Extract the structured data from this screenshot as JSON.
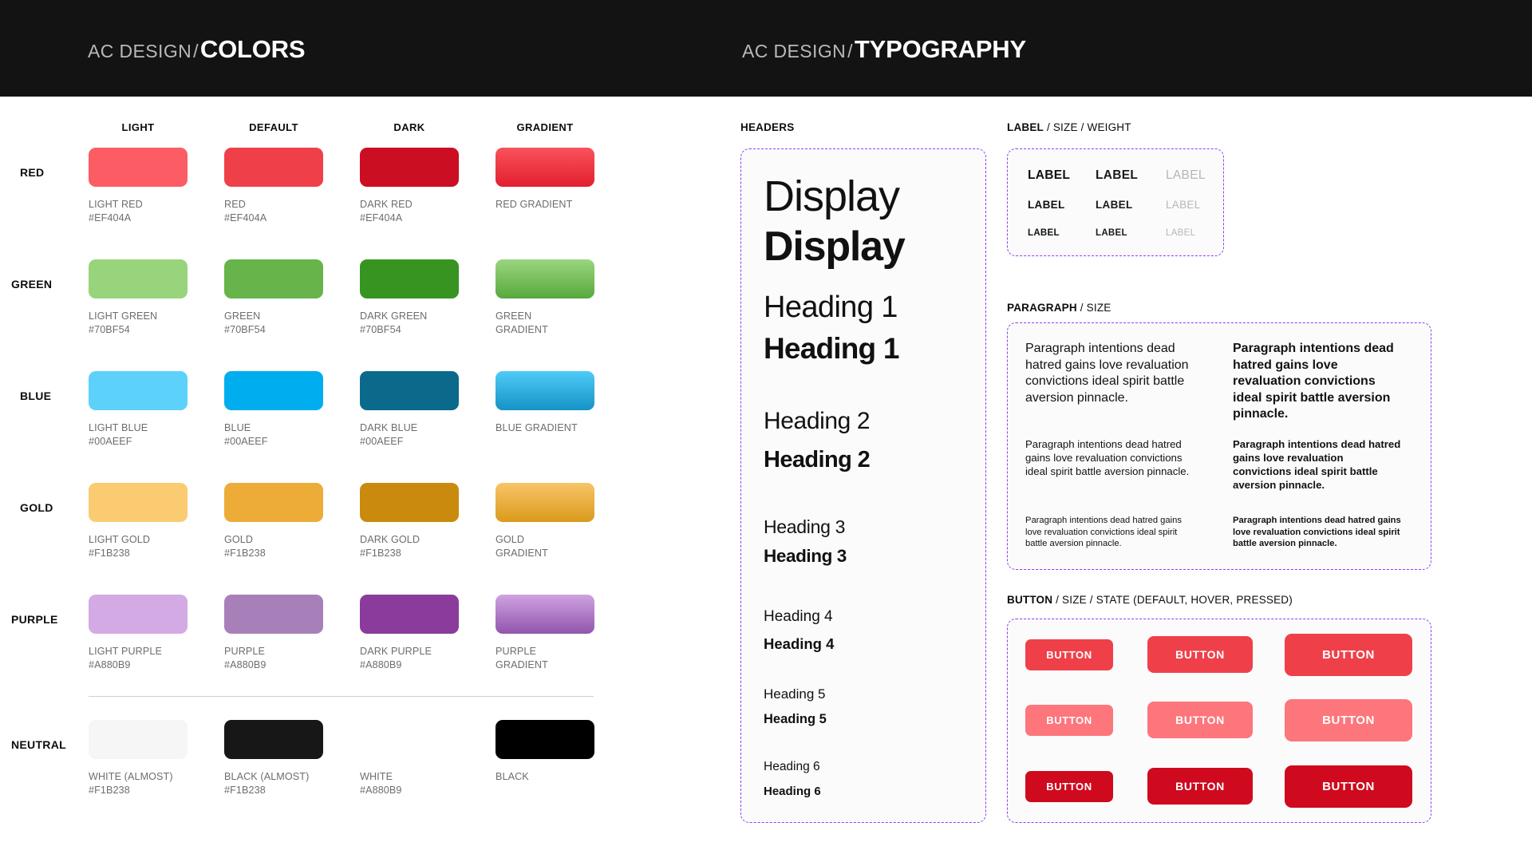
{
  "header": {
    "left": {
      "brand": "AC DESIGN",
      "separator": "/",
      "title": "COLORS"
    },
    "right": {
      "brand": "AC DESIGN",
      "separator": "/",
      "title": "TYPOGRAPHY"
    },
    "background": "#131313",
    "brand_color": "#b9b9b9",
    "title_color": "#ffffff"
  },
  "colors_section": {
    "column_headers": [
      "LIGHT",
      "DEFAULT",
      "DARK",
      "GRADIENT"
    ],
    "divider_color": "#cfcfcf",
    "rows": [
      {
        "row_label": "RED",
        "swatches": [
          {
            "caption": "LIGHT RED\n#EF404A",
            "fill": "#FC5C63",
            "type": "solid"
          },
          {
            "caption": "RED\n#EF404A",
            "fill": "#EF404A",
            "type": "solid"
          },
          {
            "caption": "DARK RED\n#EF404A",
            "fill": "#CC0E22",
            "type": "solid"
          },
          {
            "caption": "RED GRADIENT",
            "fill": "linear-gradient(180deg,#F9525C 0%,#E21F2E 100%)",
            "type": "gradient"
          }
        ]
      },
      {
        "row_label": "GREEN",
        "swatches": [
          {
            "caption": "LIGHT GREEN\n#70BF54",
            "fill": "#97D47C",
            "type": "solid"
          },
          {
            "caption": "GREEN\n#70BF54",
            "fill": "#66B44A",
            "type": "solid"
          },
          {
            "caption": "DARK GREEN\n#70BF54",
            "fill": "#379420",
            "type": "solid"
          },
          {
            "caption": "GREEN\nGRADIENT",
            "fill": "linear-gradient(180deg,#9BD57F 0%,#57A93C 100%)",
            "type": "gradient"
          }
        ]
      },
      {
        "row_label": "BLUE",
        "swatches": [
          {
            "caption": "LIGHT BLUE\n#00AEEF",
            "fill": "#5CD2FA",
            "type": "solid"
          },
          {
            "caption": "BLUE\n#00AEEF",
            "fill": "#00AEEF",
            "type": "solid"
          },
          {
            "caption": "DARK BLUE\n#00AEEF",
            "fill": "#0B6A8C",
            "type": "solid"
          },
          {
            "caption": "BLUE GRADIENT",
            "fill": "linear-gradient(180deg,#4FCBF6 0%,#1493C6 100%)",
            "type": "gradient"
          }
        ]
      },
      {
        "row_label": "GOLD",
        "swatches": [
          {
            "caption": "LIGHT GOLD\n#F1B238",
            "fill": "#FBCB72",
            "type": "solid"
          },
          {
            "caption": "GOLD\n#F1B238",
            "fill": "#EDAC38",
            "type": "solid"
          },
          {
            "caption": "DARK GOLD\n#F1B238",
            "fill": "#C98A0D",
            "type": "solid"
          },
          {
            "caption": "GOLD\nGRADIENT",
            "fill": "linear-gradient(180deg,#F8C468 0%,#DA9A1B 100%)",
            "type": "gradient"
          }
        ]
      },
      {
        "row_label": "PURPLE",
        "swatches": [
          {
            "caption": "LIGHT PURPLE\n#A880B9",
            "fill": "#D4AAE4",
            "type": "solid"
          },
          {
            "caption": "PURPLE\n#A880B9",
            "fill": "#A880B9",
            "type": "solid"
          },
          {
            "caption": "DARK PURPLE\n#A880B9",
            "fill": "#8B3B9B",
            "type": "solid"
          },
          {
            "caption": "PURPLE\nGRADIENT",
            "fill": "linear-gradient(180deg,#CFA3E0 0%,#9254AD 100%)",
            "type": "gradient"
          }
        ]
      },
      {
        "row_label": "NEUTRAL",
        "swatches": [
          {
            "caption": "WHITE (ALMOST)\n#F1B238",
            "fill": "#F6F6F6",
            "type": "solid"
          },
          {
            "caption": "BLACK (ALMOST)\n#F1B238",
            "fill": "#171717",
            "type": "solid"
          },
          {
            "caption": "WHITE\n#A880B9",
            "fill": "#FFFFFF",
            "type": "solid"
          },
          {
            "caption": "BLACK",
            "fill": "#000000",
            "type": "solid"
          }
        ]
      }
    ]
  },
  "typography_section": {
    "headers_label": "HEADERS",
    "headers": [
      {
        "light": "Display",
        "bold": "Display"
      },
      {
        "light": "Heading 1",
        "bold": "Heading 1"
      },
      {
        "light": "Heading 2",
        "bold": "Heading 2"
      },
      {
        "light": "Heading 3",
        "bold": "Heading 3"
      },
      {
        "light": "Heading 4",
        "bold": "Heading 4"
      },
      {
        "light": "Heading 5",
        "bold": "Heading 5"
      },
      {
        "light": "Heading 6",
        "bold": "Heading 6"
      }
    ],
    "label_group": {
      "title_strong": "LABEL",
      "title_rest": " / SIZE / WEIGHT",
      "cells": [
        [
          "LABEL",
          "LABEL",
          "LABEL"
        ],
        [
          "LABEL",
          "LABEL",
          "LABEL"
        ],
        [
          "LABEL",
          "LABEL",
          "LABEL"
        ]
      ],
      "muted_color": "#b6b6b6"
    },
    "paragraph_group": {
      "title_strong": "PARAGRAPH",
      "title_rest": " / SIZE",
      "text": "Paragraph intentions dead hatred gains love revaluation convictions ideal spirit battle aversion pinnacle."
    },
    "button_group": {
      "title_strong": "BUTTON",
      "title_rest": " / SIZE / STATE (DEFAULT, HOVER, PRESSED)",
      "label": "BUTTON",
      "states": [
        {
          "name": "DEFAULT",
          "fill": "#EF404A"
        },
        {
          "name": "HOVER",
          "fill": "#FC767C"
        },
        {
          "name": "PRESSED",
          "fill": "#CF0A1E"
        }
      ],
      "sizes": [
        "small",
        "medium",
        "large"
      ]
    },
    "dash_border_color": "#8d3ff0",
    "box_background": "#fbfbfb"
  }
}
